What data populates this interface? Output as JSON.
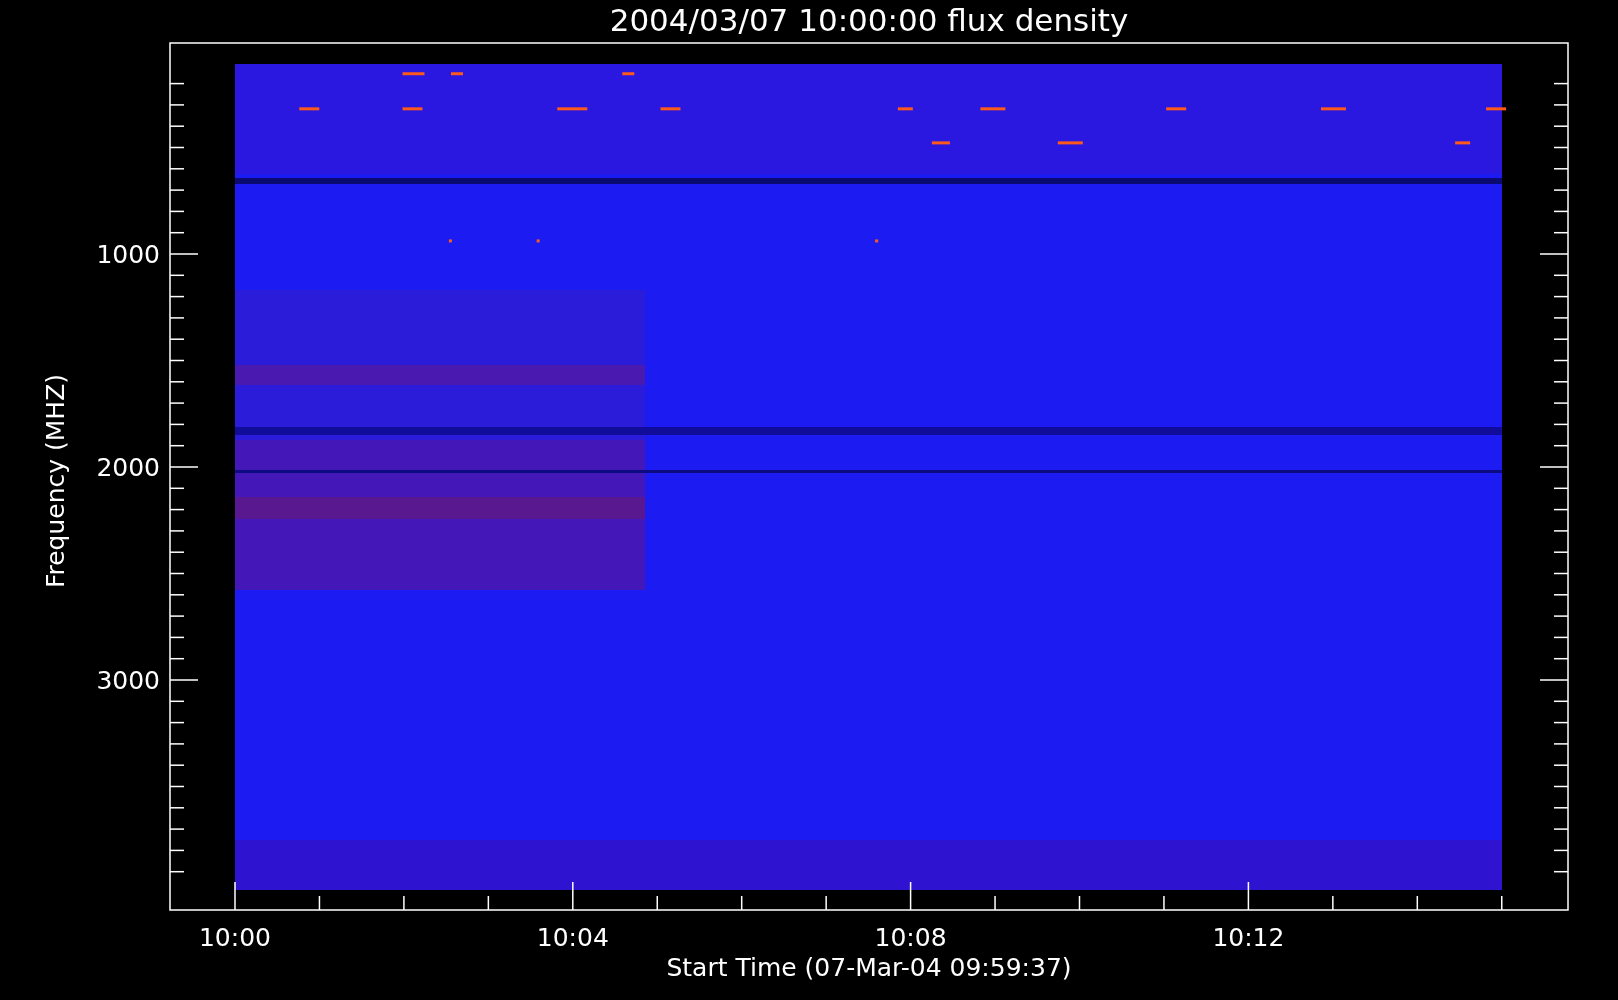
{
  "plot": {
    "title": "2004/03/07 10:00:00 flux density",
    "xlabel": "Start Time (07-Mar-04 09:59:37)",
    "ylabel": "Frequency (MHZ)",
    "xtick_labels": [
      "10:00",
      "10:04",
      "10:08",
      "10:12"
    ],
    "ytick_labels": [
      "1000",
      "2000",
      "3000"
    ]
  }
}
